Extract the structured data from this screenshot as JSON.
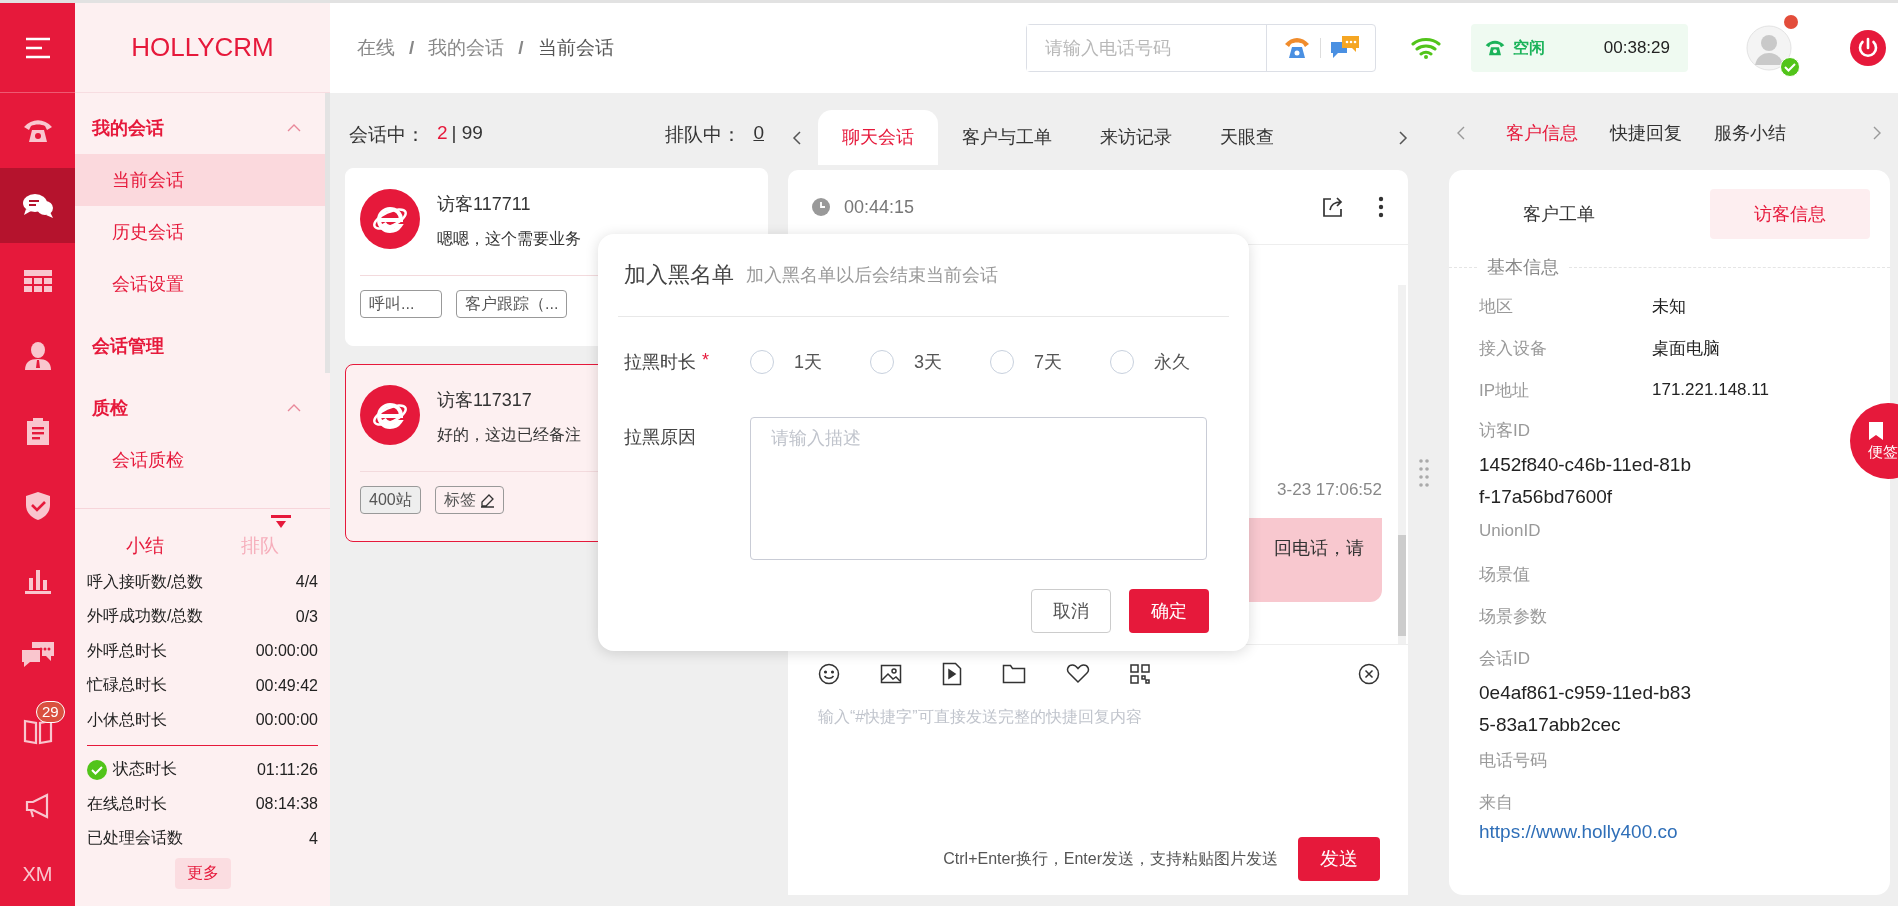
{
  "rail": {
    "items": [
      {
        "kind": "phone",
        "selected": false
      },
      {
        "kind": "chat",
        "selected": true
      },
      {
        "kind": "grid",
        "selected": false
      },
      {
        "kind": "person",
        "selected": false
      },
      {
        "kind": "clipboard",
        "selected": false
      },
      {
        "kind": "shield",
        "selected": false
      },
      {
        "kind": "chart",
        "selected": false
      },
      {
        "kind": "message",
        "selected": false
      },
      {
        "kind": "book",
        "selected": false,
        "badge": "29"
      },
      {
        "kind": "megaphone",
        "selected": false
      }
    ],
    "footer": "XM"
  },
  "logo": "HOLLYCRM",
  "menu": [
    {
      "label": "我的会话",
      "expanded": true,
      "children": [
        {
          "label": "当前会话",
          "selected": true
        },
        {
          "label": "历史会话",
          "selected": false
        },
        {
          "label": "会话设置",
          "selected": false
        }
      ]
    },
    {
      "label": "会话管理"
    },
    {
      "label": "质检",
      "expanded": true,
      "children": [
        {
          "label": "会话质检",
          "selected": false
        }
      ]
    }
  ],
  "stats": {
    "tabs": [
      {
        "label": "小结",
        "selected": true
      },
      {
        "label": "排队",
        "selected": false
      }
    ],
    "rows": [
      {
        "label": "呼入接听数/总数",
        "value": "4/4"
      },
      {
        "label": "外呼成功数/总数",
        "value": "0/3"
      },
      {
        "label": "外呼总时长",
        "value": "00:00:00"
      },
      {
        "label": "忙碌总时长",
        "value": "00:49:42"
      },
      {
        "label": "小休总时长",
        "value": "00:00:00"
      }
    ],
    "totals": [
      {
        "label": "状态时长",
        "value": "01:11:26",
        "kind": "status"
      },
      {
        "label": "在线总时长",
        "value": "08:14:38",
        "kind": "plain"
      },
      {
        "label": "已处理会话数",
        "value": "4",
        "kind": "plain"
      }
    ],
    "more": "更多"
  },
  "breadcrumb": {
    "separator": "/",
    "items": [
      "在线",
      "我的会话",
      "当前会话"
    ]
  },
  "phone_search": {
    "placeholder": "请输入电话号码"
  },
  "agent_status": {
    "label": "空闲",
    "timer": "00:38:29"
  },
  "sessions": {
    "active_label": "会话中：",
    "active": "2",
    "limit": "| 99",
    "queue_label": "排队中：",
    "queue": "0",
    "cards": [
      {
        "name": "访客117711",
        "message": "嗯嗯，这个需要业务",
        "selected": false,
        "tags": [
          {
            "label": "呼叫...",
            "kind": "tag"
          },
          {
            "label": "客户跟踪（...",
            "kind": "tag"
          }
        ]
      },
      {
        "name": "访客117317",
        "message": "好的，这边已经备注",
        "selected": true,
        "tags": [
          {
            "label": "400站",
            "kind": "source"
          },
          {
            "label": "标签",
            "kind": "edit"
          }
        ]
      }
    ]
  },
  "chat": {
    "tabs": [
      {
        "label": "聊天会话",
        "selected": true
      },
      {
        "label": "客户与工单",
        "selected": false
      },
      {
        "label": "来访记录",
        "selected": false
      },
      {
        "label": "天眼查",
        "selected": false
      }
    ],
    "timer": "00:44:15",
    "messages": [
      {
        "time": "3-23 17:06:52",
        "text": "回电话，请"
      }
    ],
    "input": {
      "placeholder": "输入“#快捷字”可直接发送完整的快捷回复内容"
    },
    "hint": "Ctrl+Enter换行，Enter发送，支持粘贴图片发送",
    "send": "发送"
  },
  "side": {
    "tabs": [
      {
        "label": "客户信息",
        "selected": true
      },
      {
        "label": "快捷回复",
        "selected": false
      },
      {
        "label": "服务小结",
        "selected": false
      }
    ],
    "subtabs": [
      {
        "label": "客户工单",
        "selected": false
      },
      {
        "label": "访客信息",
        "selected": true
      }
    ],
    "section": "基本信息",
    "fields": [
      {
        "label": "地区",
        "value": "未知",
        "kind": "inline"
      },
      {
        "label": "接入设备",
        "value": "桌面电脑",
        "kind": "inline"
      },
      {
        "label": "IP地址",
        "value": "171.221.148.11",
        "kind": "inline"
      },
      {
        "label": "访客ID",
        "value": "1452f840-c46b-11ed-81bf-17a56bd7600f",
        "kind": "stacked"
      },
      {
        "label": "UnionID",
        "kind": "stacked"
      },
      {
        "label": "场景值",
        "kind": "stacked"
      },
      {
        "label": "场景参数",
        "kind": "stacked"
      },
      {
        "label": "会话ID",
        "value": "0e4af861-c959-11ed-b835-83a17abb2cec",
        "kind": "stacked"
      },
      {
        "label": "电话号码",
        "kind": "stacked"
      },
      {
        "label": "来自",
        "value": "https://www.holly400.co",
        "kind": "link"
      }
    ]
  },
  "note_button": "便签",
  "dialog": {
    "title": "加入黑名单",
    "subtitle": "加入黑名单以后会结束当前会话",
    "duration_label": "拉黑时长",
    "required": "*",
    "options": [
      {
        "label": "1天",
        "selected": false
      },
      {
        "label": "3天",
        "selected": false
      },
      {
        "label": "7天",
        "selected": false
      },
      {
        "label": "永久",
        "selected": false
      }
    ],
    "reason_label": "拉黑原因",
    "reason_placeholder": "请输入描述",
    "cancel": "取消",
    "confirm": "确定"
  }
}
